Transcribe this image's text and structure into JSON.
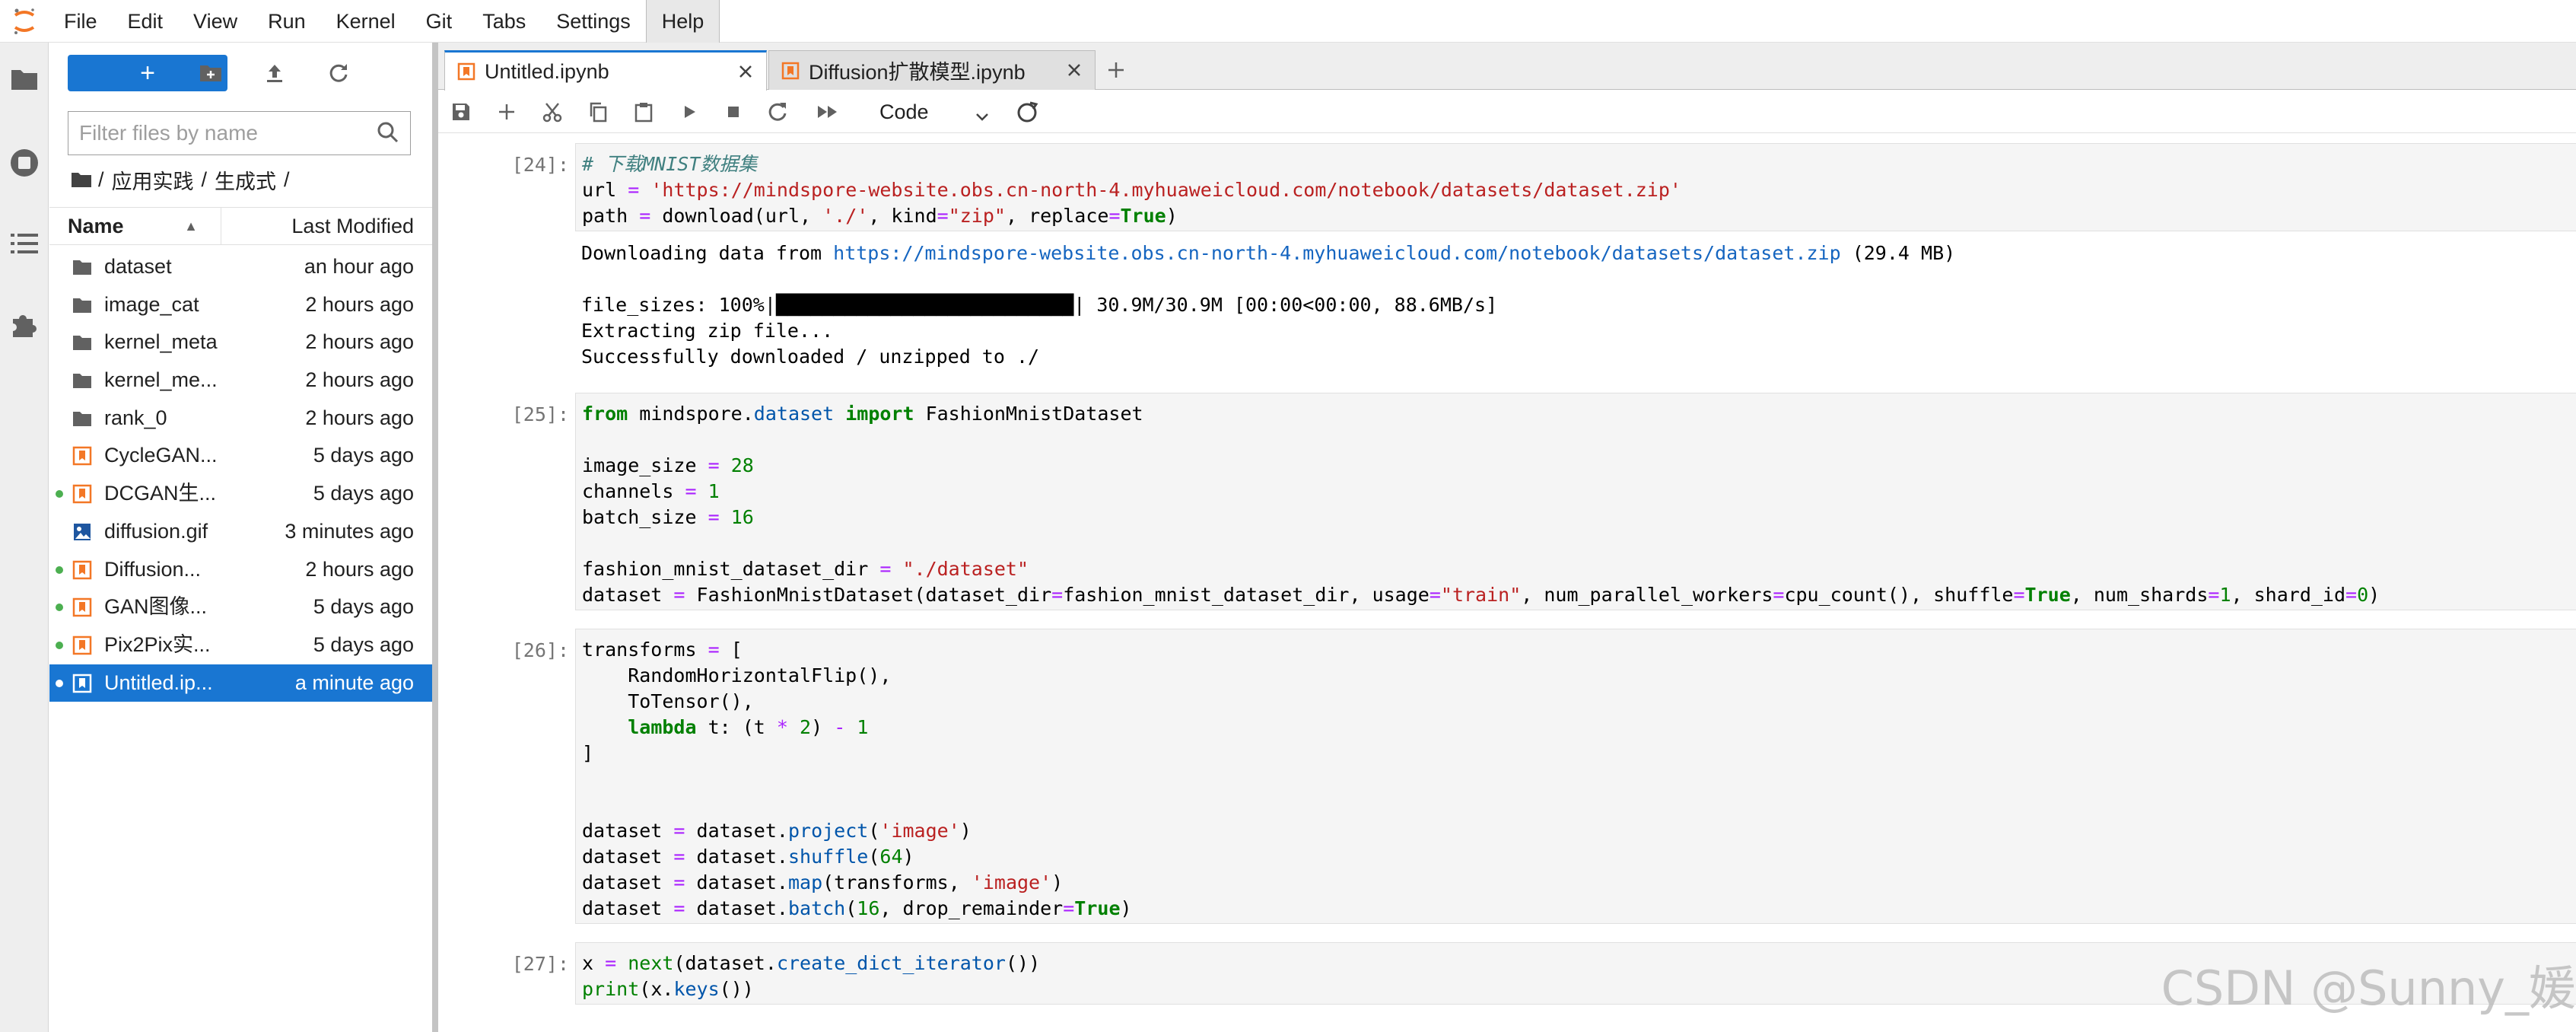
{
  "menubar": {
    "items": [
      "File",
      "Edit",
      "View",
      "Run",
      "Kernel",
      "Git",
      "Tabs",
      "Settings",
      "Help"
    ]
  },
  "filebrowser": {
    "new_label": "+",
    "filter_placeholder": "Filter files by name",
    "breadcrumb": [
      "/",
      "应用实践",
      "/",
      "生成式",
      "/"
    ],
    "columns": {
      "name": "Name",
      "modified": "Last Modified"
    },
    "files": [
      {
        "name": "dataset",
        "modified": "an hour ago",
        "type": "folder",
        "running": false
      },
      {
        "name": "image_cat",
        "modified": "2 hours ago",
        "type": "folder",
        "running": false
      },
      {
        "name": "kernel_meta",
        "modified": "2 hours ago",
        "type": "folder",
        "running": false
      },
      {
        "name": "kernel_me...",
        "modified": "2 hours ago",
        "type": "folder",
        "running": false
      },
      {
        "name": "rank_0",
        "modified": "2 hours ago",
        "type": "folder",
        "running": false
      },
      {
        "name": "CycleGAN...",
        "modified": "5 days ago",
        "type": "notebook",
        "running": false
      },
      {
        "name": "DCGAN生...",
        "modified": "5 days ago",
        "type": "notebook",
        "running": true
      },
      {
        "name": "diffusion.gif",
        "modified": "3 minutes ago",
        "type": "image",
        "running": false
      },
      {
        "name": "Diffusion...",
        "modified": "2 hours ago",
        "type": "notebook",
        "running": true
      },
      {
        "name": "GAN图像...",
        "modified": "5 days ago",
        "type": "notebook",
        "running": true
      },
      {
        "name": "Pix2Pix实...",
        "modified": "5 days ago",
        "type": "notebook",
        "running": true
      },
      {
        "name": "Untitled.ip...",
        "modified": "a minute ago",
        "type": "notebook",
        "running": true,
        "selected": true
      }
    ]
  },
  "tabs": [
    {
      "label": "Untitled.ipynb",
      "active": true
    },
    {
      "label": "Diffusion扩散模型.ipynb",
      "active": false
    }
  ],
  "toolbar": {
    "cell_type": "Code"
  },
  "cells": [
    {
      "prompt": "[24]:",
      "input": [
        [
          [
            "c",
            "# 下载MNIST数据集"
          ]
        ],
        [
          [
            "",
            "url "
          ],
          [
            "o",
            "="
          ],
          [
            "",
            " "
          ],
          [
            "s",
            "'https://mindspore-website.obs.cn-north-4.myhuaweicloud.com/notebook/datasets/dataset.zip'"
          ]
        ],
        [
          [
            "",
            "path "
          ],
          [
            "o",
            "="
          ],
          [
            "",
            " download(url, "
          ],
          [
            "s",
            "'./'"
          ],
          [
            "",
            ", kind"
          ],
          [
            "o",
            "="
          ],
          [
            "s",
            "\"zip\""
          ],
          [
            "",
            ", replace"
          ],
          [
            "o",
            "="
          ],
          [
            "k",
            "True"
          ],
          [
            "",
            ")"
          ]
        ]
      ],
      "output": [
        [
          [
            "",
            "Downloading data from "
          ],
          [
            "link",
            "https://mindspore-website.obs.cn-north-4.myhuaweicloud.com/notebook/datasets/dataset.zip"
          ],
          [
            "",
            " (29.4 MB)"
          ]
        ],
        [
          [
            "",
            ""
          ]
        ],
        [
          [
            "",
            "file_sizes: 100%|"
          ],
          [
            "bar",
            "██████████████████████████"
          ],
          [
            "",
            "| 30.9M/30.9M [00:00<00:00, 88.6MB/s]"
          ]
        ],
        [
          [
            "",
            "Extracting zip file..."
          ]
        ],
        [
          [
            "",
            "Successfully downloaded / unzipped to ./"
          ]
        ]
      ]
    },
    {
      "prompt": "[25]:",
      "input": [
        [
          [
            "k",
            "from"
          ],
          [
            "",
            " mindspore"
          ],
          [
            "",
            "."
          ],
          [
            "f",
            "dataset"
          ],
          [
            "",
            " "
          ],
          [
            "k",
            "import"
          ],
          [
            "",
            " FashionMnistDataset"
          ]
        ],
        [
          [
            "",
            ""
          ]
        ],
        [
          [
            "",
            "image_size "
          ],
          [
            "o",
            "="
          ],
          [
            "",
            " "
          ],
          [
            "n",
            "28"
          ]
        ],
        [
          [
            "",
            "channels "
          ],
          [
            "o",
            "="
          ],
          [
            "",
            " "
          ],
          [
            "n",
            "1"
          ]
        ],
        [
          [
            "",
            "batch_size "
          ],
          [
            "o",
            "="
          ],
          [
            "",
            " "
          ],
          [
            "n",
            "16"
          ]
        ],
        [
          [
            "",
            ""
          ]
        ],
        [
          [
            "",
            "fashion_mnist_dataset_dir "
          ],
          [
            "o",
            "="
          ],
          [
            "",
            " "
          ],
          [
            "s",
            "\"./dataset\""
          ]
        ],
        [
          [
            "",
            "dataset "
          ],
          [
            "o",
            "="
          ],
          [
            "",
            " FashionMnistDataset(dataset_dir"
          ],
          [
            "o",
            "="
          ],
          [
            "",
            "fashion_mnist_dataset_dir, usage"
          ],
          [
            "o",
            "="
          ],
          [
            "s",
            "\"train\""
          ],
          [
            "",
            ", num_parallel_workers"
          ],
          [
            "o",
            "="
          ],
          [
            "",
            "cpu_count(), shuffle"
          ],
          [
            "o",
            "="
          ],
          [
            "k",
            "True"
          ],
          [
            "",
            ", num_shards"
          ],
          [
            "o",
            "="
          ],
          [
            "n",
            "1"
          ],
          [
            "",
            ", shard_id"
          ],
          [
            "o",
            "="
          ],
          [
            "n",
            "0"
          ],
          [
            "",
            ")"
          ]
        ]
      ],
      "output": []
    },
    {
      "prompt": "[26]:",
      "input": [
        [
          [
            "",
            "transforms "
          ],
          [
            "o",
            "="
          ],
          [
            "",
            " ["
          ]
        ],
        [
          [
            "",
            "    RandomHorizontalFlip(),"
          ]
        ],
        [
          [
            "",
            "    ToTensor(),"
          ]
        ],
        [
          [
            "",
            "    "
          ],
          [
            "k",
            "lambda"
          ],
          [
            "",
            " t: (t "
          ],
          [
            "o",
            "*"
          ],
          [
            "",
            " "
          ],
          [
            "n",
            "2"
          ],
          [
            "",
            ") "
          ],
          [
            "o",
            "-"
          ],
          [
            "",
            " "
          ],
          [
            "n",
            "1"
          ]
        ],
        [
          [
            "",
            "]"
          ]
        ],
        [
          [
            "",
            ""
          ]
        ],
        [
          [
            "",
            ""
          ]
        ],
        [
          [
            "",
            "dataset "
          ],
          [
            "o",
            "="
          ],
          [
            "",
            " dataset"
          ],
          [
            "",
            "."
          ],
          [
            "f",
            "project"
          ],
          [
            "",
            "("
          ],
          [
            "s",
            "'image'"
          ],
          [
            "",
            ")"
          ]
        ],
        [
          [
            "",
            "dataset "
          ],
          [
            "o",
            "="
          ],
          [
            "",
            " dataset"
          ],
          [
            "",
            "."
          ],
          [
            "f",
            "shuffle"
          ],
          [
            "",
            "("
          ],
          [
            "n",
            "64"
          ],
          [
            "",
            ")"
          ]
        ],
        [
          [
            "",
            "dataset "
          ],
          [
            "o",
            "="
          ],
          [
            "",
            " dataset"
          ],
          [
            "",
            "."
          ],
          [
            "f",
            "map"
          ],
          [
            "",
            "(transforms, "
          ],
          [
            "s",
            "'image'"
          ],
          [
            "",
            ")"
          ]
        ],
        [
          [
            "",
            "dataset "
          ],
          [
            "o",
            "="
          ],
          [
            "",
            " dataset"
          ],
          [
            "",
            "."
          ],
          [
            "f",
            "batch"
          ],
          [
            "",
            "("
          ],
          [
            "n",
            "16"
          ],
          [
            "",
            ", drop_remainder"
          ],
          [
            "o",
            "="
          ],
          [
            "k",
            "True"
          ],
          [
            "",
            ")"
          ]
        ]
      ],
      "output": []
    },
    {
      "prompt": "[27]:",
      "input": [
        [
          [
            "",
            "x "
          ],
          [
            "o",
            "="
          ],
          [
            "",
            " "
          ],
          [
            "n",
            "next"
          ],
          [
            "",
            "(dataset"
          ],
          [
            "",
            "."
          ],
          [
            "f",
            "create_dict_iterator"
          ],
          [
            "",
            "())"
          ]
        ],
        [
          [
            "n",
            "print"
          ],
          [
            "",
            "(x"
          ],
          [
            "",
            "."
          ],
          [
            "f",
            "keys"
          ],
          [
            "",
            "())"
          ]
        ]
      ],
      "output": []
    }
  ],
  "watermark": "CSDN @Sunny_媛",
  "colors": {
    "accent": "#1976d2",
    "notebook_orange": "#f37726",
    "running_dot": "#4caf50"
  }
}
